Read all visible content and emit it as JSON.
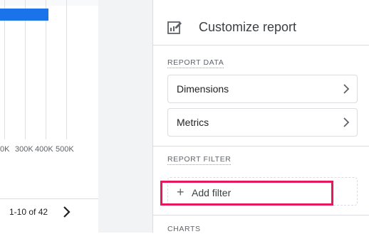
{
  "chart": {
    "type": "bar",
    "tick_labels": [
      "0K",
      "300K",
      "400K",
      "500K"
    ],
    "bar_value_fraction": 0.7
  },
  "pager": {
    "range_label": "1-10 of 42"
  },
  "panel": {
    "title": "Customize report",
    "report_data_label": "REPORT DATA",
    "dimensions_label": "Dimensions",
    "metrics_label": "Metrics",
    "report_filter_label": "REPORT FILTER",
    "add_filter_label": "Add filter",
    "charts_label": "CHARTS"
  },
  "colors": {
    "bar": "#1a73e8",
    "highlight": "#e8175d"
  },
  "icons": {
    "panel_icon": "edit-report-icon",
    "chevron": "chevron-right-icon",
    "plus": "plus-icon"
  }
}
